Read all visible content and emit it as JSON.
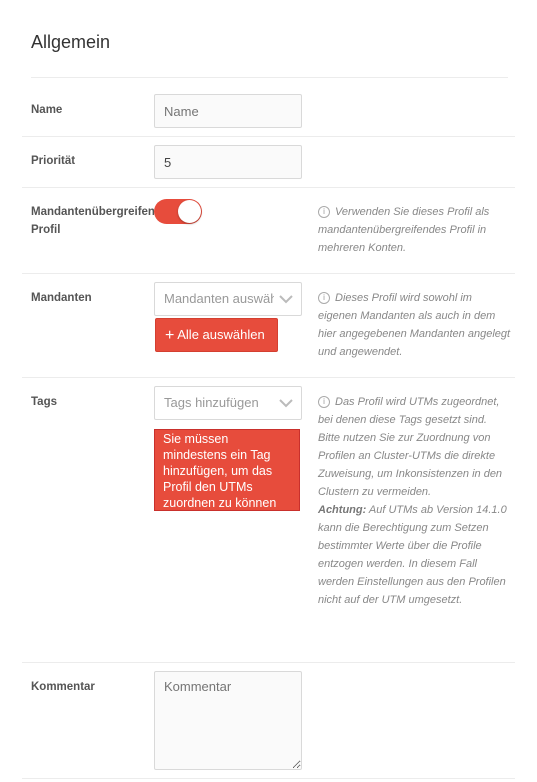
{
  "section": {
    "title": "Allgemein"
  },
  "name": {
    "label": "Name",
    "placeholder": "Name",
    "value": ""
  },
  "priority": {
    "label": "Priorität",
    "value": "5"
  },
  "cross_tenant": {
    "label_line1": "Mandantenübergreifendes",
    "label_line2": "Profil",
    "enabled": true,
    "help": "Verwenden Sie dieses Profil als mandantenübergreifendes Profil in mehreren Konten."
  },
  "tenants": {
    "label": "Mandanten",
    "placeholder": "Mandanten auswählen",
    "select_all_label": "Alle auswählen",
    "help": "Dieses Profil wird sowohl im eigenen Mandanten als auch in dem hier angegebenen Mandanten angelegt und angewendet."
  },
  "tags": {
    "label": "Tags",
    "placeholder": "Tags hinzufügen",
    "error": "Sie müssen mindestens ein Tag hinzufügen, um das Profil den UTMs zuordnen zu können",
    "help_p1": "Das Profil wird UTMs zugeordnet, bei denen diese Tags gesetzt sind.",
    "help_p2": "Bitte nutzen Sie zur Zuordnung von Profilen an Cluster-UTMs die direkte Zuweisung, um Inkonsistenzen in den Clustern zu vermeiden.",
    "help_warning_label": "Achtung:",
    "help_warning": " Auf UTMs ab Version 14.1.0 kann die Berechtigung zum Setzen bestimmter Werte über die Profile entzogen werden. In diesem Fall werden Einstellungen aus den Profilen nicht auf der UTM umgesetzt."
  },
  "comment": {
    "label": "Kommentar",
    "placeholder": "Kommentar"
  },
  "icons": {
    "info": "info-circle-icon",
    "chevron": "chevron-down-icon",
    "plus": "plus-icon"
  },
  "colors": {
    "accent": "#e74c3c"
  }
}
